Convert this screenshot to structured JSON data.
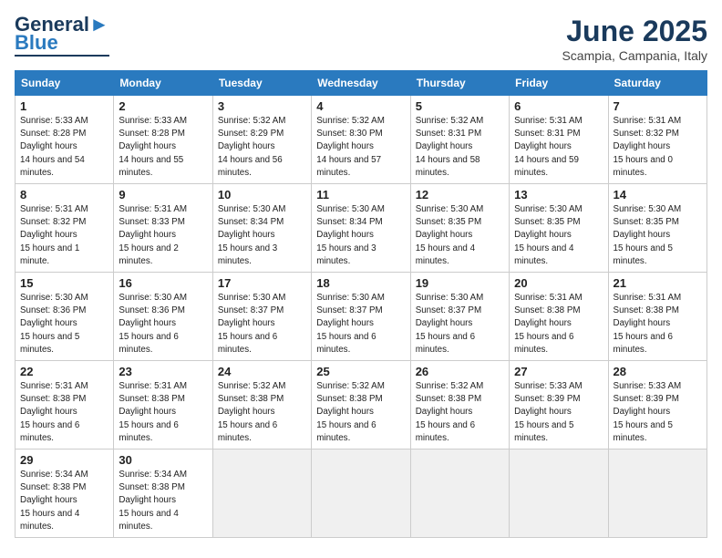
{
  "logo": {
    "part1": "General",
    "part2": "Blue"
  },
  "title": "June 2025",
  "location": "Scampia, Campania, Italy",
  "days_of_week": [
    "Sunday",
    "Monday",
    "Tuesday",
    "Wednesday",
    "Thursday",
    "Friday",
    "Saturday"
  ],
  "weeks": [
    [
      {
        "day": 1,
        "sunrise": "5:33 AM",
        "sunset": "8:28 PM",
        "daylight": "14 hours and 54 minutes."
      },
      {
        "day": 2,
        "sunrise": "5:33 AM",
        "sunset": "8:28 PM",
        "daylight": "14 hours and 55 minutes."
      },
      {
        "day": 3,
        "sunrise": "5:32 AM",
        "sunset": "8:29 PM",
        "daylight": "14 hours and 56 minutes."
      },
      {
        "day": 4,
        "sunrise": "5:32 AM",
        "sunset": "8:30 PM",
        "daylight": "14 hours and 57 minutes."
      },
      {
        "day": 5,
        "sunrise": "5:32 AM",
        "sunset": "8:31 PM",
        "daylight": "14 hours and 58 minutes."
      },
      {
        "day": 6,
        "sunrise": "5:31 AM",
        "sunset": "8:31 PM",
        "daylight": "14 hours and 59 minutes."
      },
      {
        "day": 7,
        "sunrise": "5:31 AM",
        "sunset": "8:32 PM",
        "daylight": "15 hours and 0 minutes."
      }
    ],
    [
      {
        "day": 8,
        "sunrise": "5:31 AM",
        "sunset": "8:32 PM",
        "daylight": "15 hours and 1 minute."
      },
      {
        "day": 9,
        "sunrise": "5:31 AM",
        "sunset": "8:33 PM",
        "daylight": "15 hours and 2 minutes."
      },
      {
        "day": 10,
        "sunrise": "5:30 AM",
        "sunset": "8:34 PM",
        "daylight": "15 hours and 3 minutes."
      },
      {
        "day": 11,
        "sunrise": "5:30 AM",
        "sunset": "8:34 PM",
        "daylight": "15 hours and 3 minutes."
      },
      {
        "day": 12,
        "sunrise": "5:30 AM",
        "sunset": "8:35 PM",
        "daylight": "15 hours and 4 minutes."
      },
      {
        "day": 13,
        "sunrise": "5:30 AM",
        "sunset": "8:35 PM",
        "daylight": "15 hours and 4 minutes."
      },
      {
        "day": 14,
        "sunrise": "5:30 AM",
        "sunset": "8:35 PM",
        "daylight": "15 hours and 5 minutes."
      }
    ],
    [
      {
        "day": 15,
        "sunrise": "5:30 AM",
        "sunset": "8:36 PM",
        "daylight": "15 hours and 5 minutes."
      },
      {
        "day": 16,
        "sunrise": "5:30 AM",
        "sunset": "8:36 PM",
        "daylight": "15 hours and 6 minutes."
      },
      {
        "day": 17,
        "sunrise": "5:30 AM",
        "sunset": "8:37 PM",
        "daylight": "15 hours and 6 minutes."
      },
      {
        "day": 18,
        "sunrise": "5:30 AM",
        "sunset": "8:37 PM",
        "daylight": "15 hours and 6 minutes."
      },
      {
        "day": 19,
        "sunrise": "5:30 AM",
        "sunset": "8:37 PM",
        "daylight": "15 hours and 6 minutes."
      },
      {
        "day": 20,
        "sunrise": "5:31 AM",
        "sunset": "8:38 PM",
        "daylight": "15 hours and 6 minutes."
      },
      {
        "day": 21,
        "sunrise": "5:31 AM",
        "sunset": "8:38 PM",
        "daylight": "15 hours and 6 minutes."
      }
    ],
    [
      {
        "day": 22,
        "sunrise": "5:31 AM",
        "sunset": "8:38 PM",
        "daylight": "15 hours and 6 minutes."
      },
      {
        "day": 23,
        "sunrise": "5:31 AM",
        "sunset": "8:38 PM",
        "daylight": "15 hours and 6 minutes."
      },
      {
        "day": 24,
        "sunrise": "5:32 AM",
        "sunset": "8:38 PM",
        "daylight": "15 hours and 6 minutes."
      },
      {
        "day": 25,
        "sunrise": "5:32 AM",
        "sunset": "8:38 PM",
        "daylight": "15 hours and 6 minutes."
      },
      {
        "day": 26,
        "sunrise": "5:32 AM",
        "sunset": "8:38 PM",
        "daylight": "15 hours and 6 minutes."
      },
      {
        "day": 27,
        "sunrise": "5:33 AM",
        "sunset": "8:39 PM",
        "daylight": "15 hours and 5 minutes."
      },
      {
        "day": 28,
        "sunrise": "5:33 AM",
        "sunset": "8:39 PM",
        "daylight": "15 hours and 5 minutes."
      }
    ],
    [
      {
        "day": 29,
        "sunrise": "5:34 AM",
        "sunset": "8:38 PM",
        "daylight": "15 hours and 4 minutes."
      },
      {
        "day": 30,
        "sunrise": "5:34 AM",
        "sunset": "8:38 PM",
        "daylight": "15 hours and 4 minutes."
      },
      null,
      null,
      null,
      null,
      null
    ]
  ]
}
